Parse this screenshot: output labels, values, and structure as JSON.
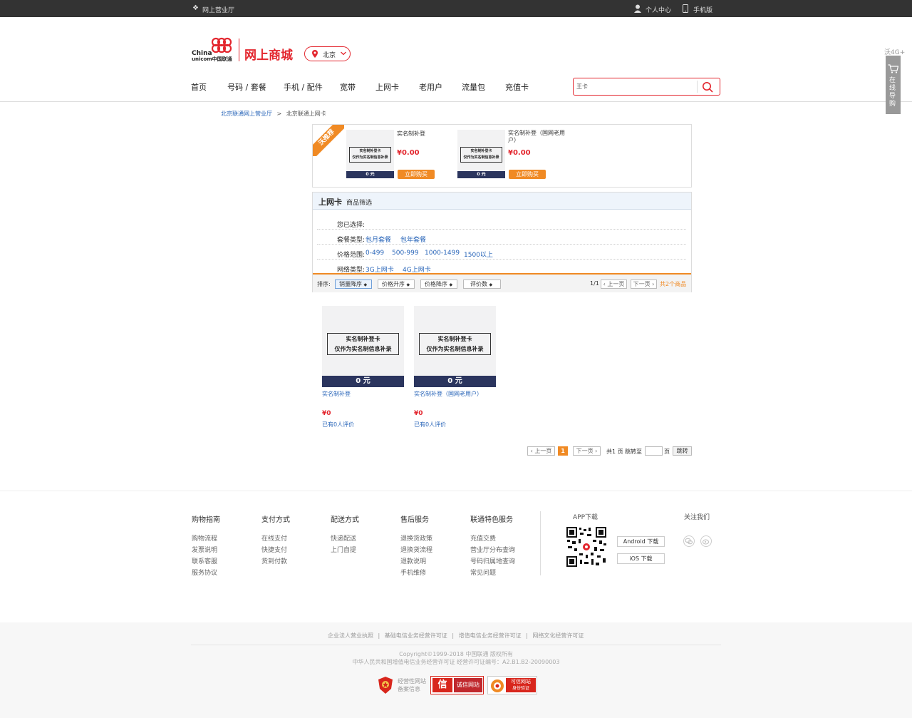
{
  "topbar": {
    "store_name": "网上营业厅",
    "personal_center": "个人中心",
    "mobile_version": "手机版"
  },
  "header": {
    "logo_en_1": "China",
    "logo_en_2": "unicom中国联通",
    "brand_title": "网上商城",
    "location": "北京",
    "search_value": "王卡"
  },
  "nav": {
    "items": [
      "首页",
      "号码 / 套餐",
      "手机 / 配件",
      "宽带",
      "上网卡",
      "老用户",
      "流量包",
      "充值卡"
    ]
  },
  "side_widget": {
    "label_top": "沃4G+",
    "label": "在线导购"
  },
  "breadcrumb": {
    "root": "北京联通网上营业厅",
    "separator": ">",
    "current": "北京联通上网卡"
  },
  "recommend": {
    "badge": "沃推荐",
    "items": [
      {
        "name": "实名制补登",
        "price": "¥0.00",
        "img_title": "实名制补登卡",
        "img_sub": "仅作为实名制信息补录",
        "img_price": "0 元",
        "buy_label": "立即购买"
      },
      {
        "name": "实名制补登（国网老用户）",
        "price": "¥0.00",
        "img_title": "实名制补登卡",
        "img_sub": "仅作为实名制信息补录",
        "img_price": "0 元",
        "buy_label": "立即购买"
      }
    ]
  },
  "filter": {
    "title": "上网卡",
    "subtitle": "商品筛选",
    "selected_label": "您已选择:",
    "package_label": "套餐类型:",
    "package_opts": [
      "包月套餐",
      "包年套餐"
    ],
    "price_label": "价格范围:",
    "price_opts": [
      "0-499",
      "500-999",
      "1000-1499",
      "1500以上"
    ],
    "network_label": "网络类型:",
    "network_opts": [
      "3G上网卡",
      "4G上网卡"
    ]
  },
  "sort": {
    "label": "排序:",
    "buttons": [
      "销量降序",
      "价格升序",
      "价格降序",
      "评价数"
    ],
    "page_info": "1/1",
    "prev": "上一页",
    "next": "下一页",
    "total_prefix": "共",
    "total_count": "2",
    "total_suffix": "个商品"
  },
  "products": [
    {
      "img_title": "实名制补登卡",
      "img_sub": "仅作为实名制信息补录",
      "img_price": "0 元",
      "name": "实名制补登",
      "price": "¥0",
      "reviews": "已有0人评价"
    },
    {
      "img_title": "实名制补登卡",
      "img_sub": "仅作为实名制信息补录",
      "img_price": "0 元",
      "name": "实名制补登（国网老用户）",
      "price": "¥0",
      "reviews": "已有0人评价"
    }
  ],
  "pagination": {
    "prev": "上一页",
    "current": "1",
    "next": "下一页",
    "total_pages": "共1 页",
    "jump_to": "跳转至",
    "page_unit": "页",
    "go": "跳转"
  },
  "footer": {
    "columns": [
      {
        "title": "购物指南",
        "links": [
          "购物流程",
          "发票说明",
          "联系客服",
          "服务协议"
        ]
      },
      {
        "title": "支付方式",
        "links": [
          "在线支付",
          "快捷支付",
          "货到付款"
        ]
      },
      {
        "title": "配送方式",
        "links": [
          "快递配送",
          "上门自提"
        ]
      },
      {
        "title": "售后服务",
        "links": [
          "退换货政策",
          "退换货流程",
          "退款说明",
          "手机维修"
        ]
      },
      {
        "title": "联通特色服务",
        "links": [
          "充值交费",
          "营业厅分布查询",
          "号码归属地查询",
          "常见问题"
        ]
      }
    ],
    "app_title": "APP下载",
    "android": "Android 下载",
    "ios": "iOS 下载",
    "follow": "关注我们",
    "licenses": [
      "企业法人营业执照",
      "基础电信业务经营许可证",
      "增值电信业务经营许可证",
      "网络文化经营许可证"
    ],
    "copyright": "Copyright©1999-2018  中国联通  版权所有",
    "icp": "中华人民共和国增值电信业务经营许可证 经营许可证编号：A2.B1.B2-20090003",
    "badge1": "经营性网站",
    "badge1_sub": "备案信息",
    "badge2": "诚信网站",
    "badge3": "可信网站",
    "badge3_sub": "身份验证"
  },
  "colors": {
    "brand_red": "#e3262e",
    "accent_orange": "#f08a24",
    "navy": "#2b355e",
    "link_blue": "#2a66b9"
  }
}
